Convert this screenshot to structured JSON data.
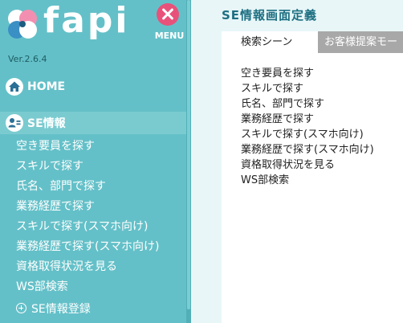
{
  "app": {
    "logo_text": "fapi",
    "menu_label": "MENU",
    "version": "Ver.2.6.4"
  },
  "sidebar": {
    "home_label": "HOME",
    "se_label": "SE情報",
    "se_items": [
      {
        "label": "空き要員を探す"
      },
      {
        "label": "スキルで探す"
      },
      {
        "label": "氏名、部門で探す"
      },
      {
        "label": "業務経歴で探す"
      },
      {
        "label": "スキルで探す(スマホ向け)"
      },
      {
        "label": "業務経歴で探す(スマホ向け)"
      },
      {
        "label": "資格取得状況を見る"
      },
      {
        "label": "WS部検索"
      }
    ],
    "register_label": "SE情報登録"
  },
  "main": {
    "title": "SE情報画面定義",
    "tabs": [
      {
        "label": "検索シーン"
      },
      {
        "label": "お客様提案モー"
      }
    ],
    "scenes": [
      {
        "label": "空き要員を探す"
      },
      {
        "label": "スキルで探す"
      },
      {
        "label": "氏名、部門で探す"
      },
      {
        "label": "業務経歴で探す"
      },
      {
        "label": "スキルで探す(スマホ向け)"
      },
      {
        "label": "業務経歴で探す(スマホ向け)"
      },
      {
        "label": "資格取得状況を見る"
      },
      {
        "label": "WS部検索"
      }
    ]
  },
  "colors": {
    "sidebar_bg": "#64c0c8",
    "sidebar_active_bg": "#7acbd0",
    "title_color": "#1d6f82",
    "menu_close_accent": "#e8527a",
    "inactive_tab_bg": "#a8a8a8"
  },
  "icons": {
    "logo_mark": "fapi-logo-icon",
    "menu_close": "close-icon",
    "home": "home-icon",
    "se_info": "person-card-icon",
    "register": "plus-circle-icon"
  }
}
